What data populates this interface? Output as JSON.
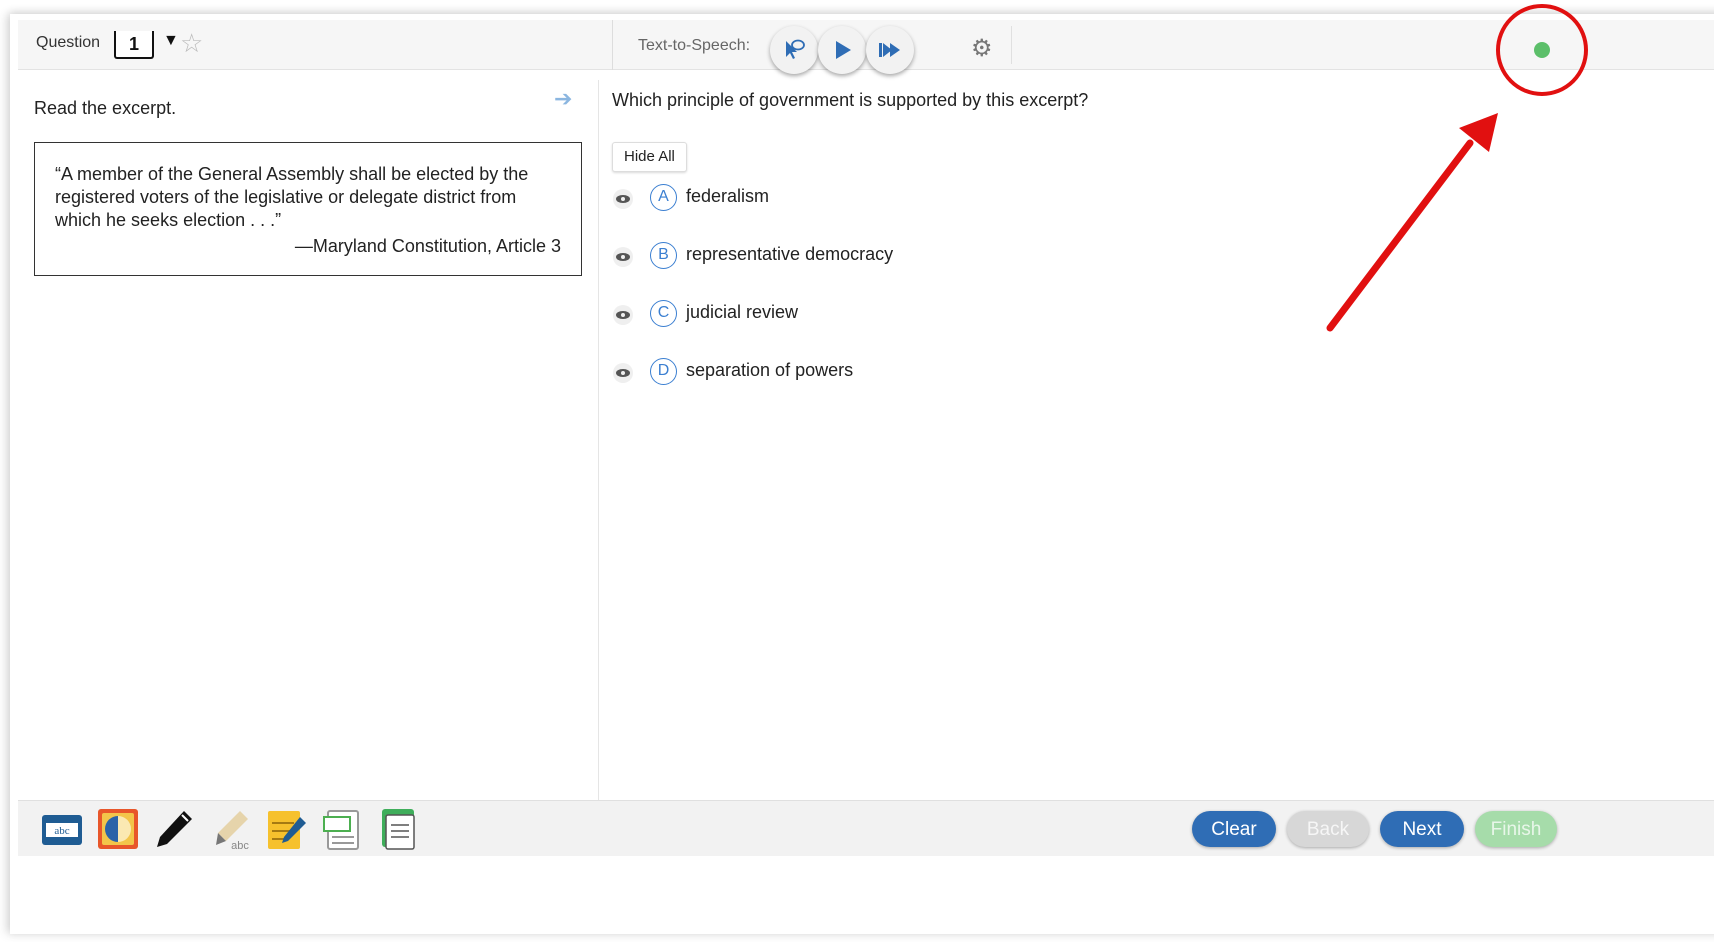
{
  "header": {
    "question_label": "Question",
    "question_number": "1",
    "caret": "▼",
    "flag_icon": "☆",
    "tts_label": "Text-to-Speech:",
    "tts_buttons": [
      "select-to-read-icon",
      "play-icon",
      "fast-forward-icon"
    ],
    "settings_icon": "⚙",
    "status_color": "#5cbf6a"
  },
  "passage": {
    "instruction": "Read the excerpt.",
    "expand_icon": "➔",
    "excerpt_lines": [
      "“A member of the General Assembly shall be elected by the",
      "registered voters of the legislative or delegate district from",
      "which he seeks election . . .”"
    ],
    "source": "—Maryland Constitution, Article 3"
  },
  "question": {
    "prompt": "Which principle of government is supported by this excerpt?",
    "hide_all_label": "Hide All",
    "options": [
      {
        "letter": "A",
        "text": "federalism"
      },
      {
        "letter": "B",
        "text": "representative democracy"
      },
      {
        "letter": "C",
        "text": "judicial review"
      },
      {
        "letter": "D",
        "text": "separation of powers"
      }
    ]
  },
  "toolbar": {
    "tools": [
      "answer-masking-icon",
      "color-contrast-icon",
      "pencil-icon",
      "highlighter-icon",
      "notepad-icon",
      "line-reader-icon",
      "notes-icon"
    ],
    "abc_label": "abc"
  },
  "navigation": {
    "clear": "Clear",
    "back": "Back",
    "next": "Next",
    "finish": "Finish"
  },
  "colors": {
    "accent": "#2f6db5",
    "annotation": "#e11010"
  }
}
